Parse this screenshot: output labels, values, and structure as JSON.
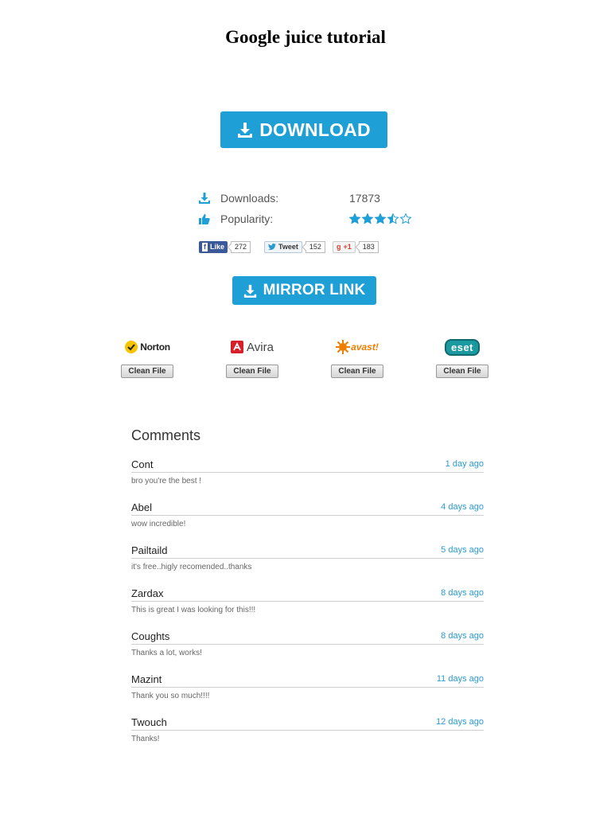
{
  "page": {
    "title": "Google juice tutorial"
  },
  "download": {
    "label": "DOWNLOAD"
  },
  "stats": {
    "downloads_label": "Downloads:",
    "downloads_value": "17873",
    "popularity_label": "Popularity:",
    "popularity_rating": 3.5,
    "popularity_max": 5
  },
  "social": {
    "facebook": {
      "label": "Like",
      "count": "272"
    },
    "twitter": {
      "label": "Tweet",
      "count": "152"
    },
    "google": {
      "label": "+1",
      "count": "183"
    }
  },
  "mirror": {
    "label": "MIRROR LINK"
  },
  "antivirus": [
    {
      "name": "Norton",
      "button": "Clean File"
    },
    {
      "name": "Avira",
      "button": "Clean File"
    },
    {
      "name": "avast!",
      "button": "Clean File"
    },
    {
      "name": "eset",
      "button": "Clean File"
    }
  ],
  "comments_title": "Comments",
  "comments": [
    {
      "author": "Cont",
      "time": "1 day ago",
      "text": "bro you're the best !"
    },
    {
      "author": "Abel",
      "time": "4 days ago",
      "text": "wow incredible!"
    },
    {
      "author": "Pailtaild",
      "time": "5 days ago",
      "text": "it's free..higly recomended..thanks"
    },
    {
      "author": "Zardax",
      "time": "8 days ago",
      "text": "This is great I was looking for this!!!"
    },
    {
      "author": "Coughts",
      "time": "8 days ago",
      "text": "Thanks a lot, works!"
    },
    {
      "author": "Mazint",
      "time": "11 days ago",
      "text": "Thank you so much!!!!"
    },
    {
      "author": "Twouch",
      "time": "12 days ago",
      "text": "Thanks!"
    }
  ],
  "colors": {
    "accent": "#1e9fd6",
    "link": "#2a9bd1",
    "facebook": "#3b5998"
  }
}
